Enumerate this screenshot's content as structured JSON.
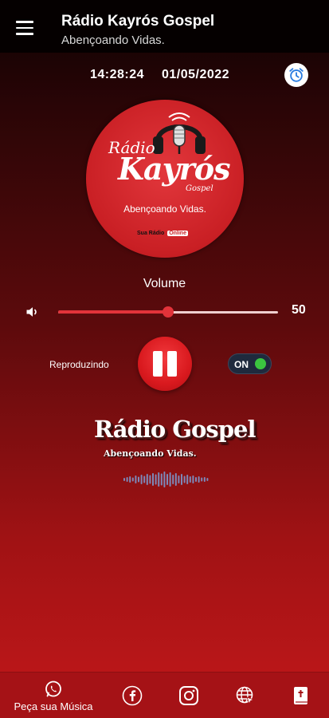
{
  "appbar": {
    "title": "Rádio Kayrós Gospel",
    "subtitle": "Abençoando Vidas.",
    "menu_icon": "hamburger-menu-icon"
  },
  "header": {
    "time": "14:28:24",
    "date": "01/05/2022",
    "alarm_icon": "alarm-clock-icon"
  },
  "logo": {
    "radio_text": "Rádio",
    "name_text": "Kayrós",
    "gospel_text": "Gospel",
    "slogan": "Abençoando Vidas.",
    "small_text": "Sua Rádio",
    "online_badge": "Online"
  },
  "player": {
    "volume_label": "Volume",
    "volume_value": "50",
    "volume_level": 0.5,
    "status_text": "Reproduzindo",
    "toggle_label": "ON",
    "toggle_on": true
  },
  "station": {
    "title": "Rádio Gospel",
    "subtitle": "Abençoando Vidas."
  },
  "bottom_nav": {
    "whatsapp_label": "Peça sua Música",
    "items": [
      "whatsapp-icon",
      "facebook-icon",
      "instagram-icon",
      "website-icon",
      "bible-icon"
    ]
  },
  "colors": {
    "accent": "#e2333a",
    "appbar": "#050000",
    "bottom_nav": "#a51216",
    "toggle_on": "#3bc53f"
  }
}
